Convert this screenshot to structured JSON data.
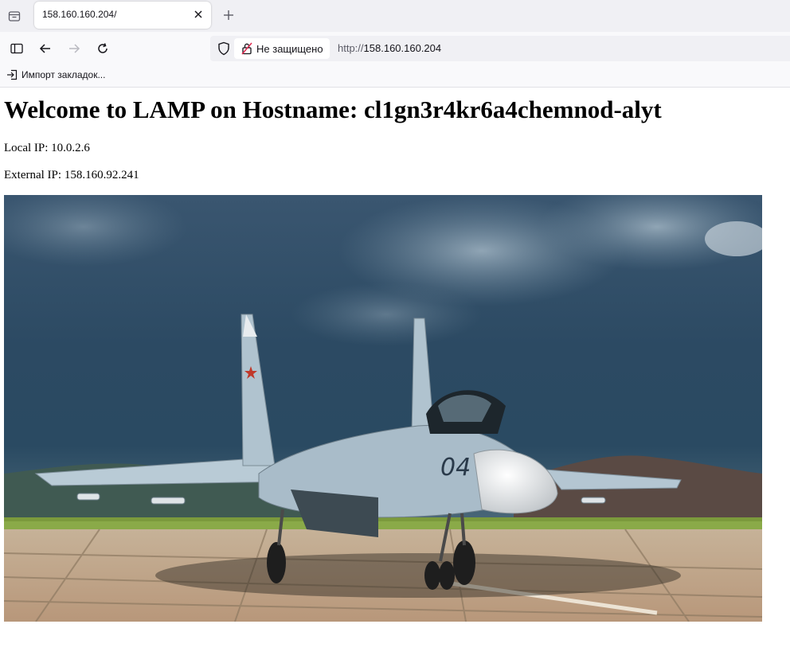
{
  "browser": {
    "tab": {
      "title": "158.160.160.204/"
    },
    "address": {
      "security_label": "Не защищено",
      "url_scheme": "http://",
      "url_host": "158.160.160.204"
    },
    "bookmarks": {
      "import_label": "Импорт закладок..."
    }
  },
  "page": {
    "heading": "Welcome to LAMP on Hostname: cl1gn3r4kr6a4chemnod-alyt",
    "local_ip": "Local IP: 10.0.2.6",
    "external_ip": "External IP: 158.160.92.241",
    "photo_number": "04"
  }
}
